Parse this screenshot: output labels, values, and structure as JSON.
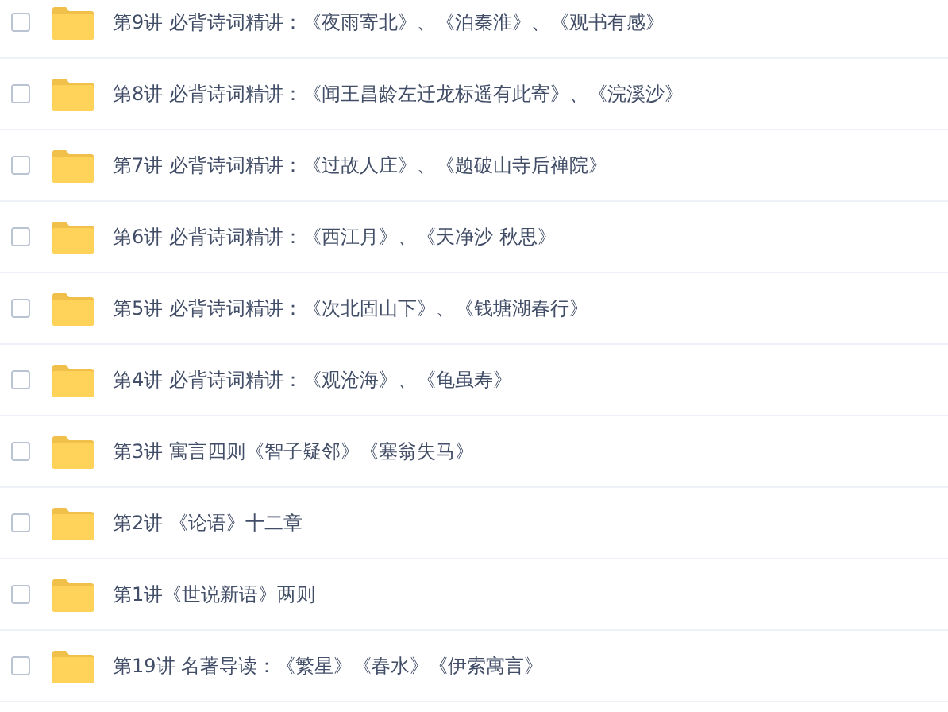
{
  "files": [
    {
      "name": "第9讲 必背诗词精讲：《夜雨寄北》、《泊秦淮》、《观书有感》",
      "checked": false
    },
    {
      "name": "第8讲 必背诗词精讲：《闻王昌龄左迁龙标遥有此寄》、《浣溪沙》",
      "checked": false
    },
    {
      "name": "第7讲 必背诗词精讲：《过故人庄》、《题破山寺后禅院》",
      "checked": false
    },
    {
      "name": "第6讲 必背诗词精讲：《西江月》、《天净沙 秋思》",
      "checked": false
    },
    {
      "name": "第5讲 必背诗词精讲：《次北固山下》、《钱塘湖春行》",
      "checked": false
    },
    {
      "name": "第4讲 必背诗词精讲：《观沧海》、《龟虽寿》",
      "checked": false
    },
    {
      "name": "第3讲 寓言四则《智子疑邻》《塞翁失马》",
      "checked": false
    },
    {
      "name": "第2讲 《论语》十二章",
      "checked": false
    },
    {
      "name": "第1讲《世说新语》两则",
      "checked": false
    },
    {
      "name": "第19讲 名著导读：《繁星》《春水》《伊索寓言》",
      "checked": false
    }
  ]
}
